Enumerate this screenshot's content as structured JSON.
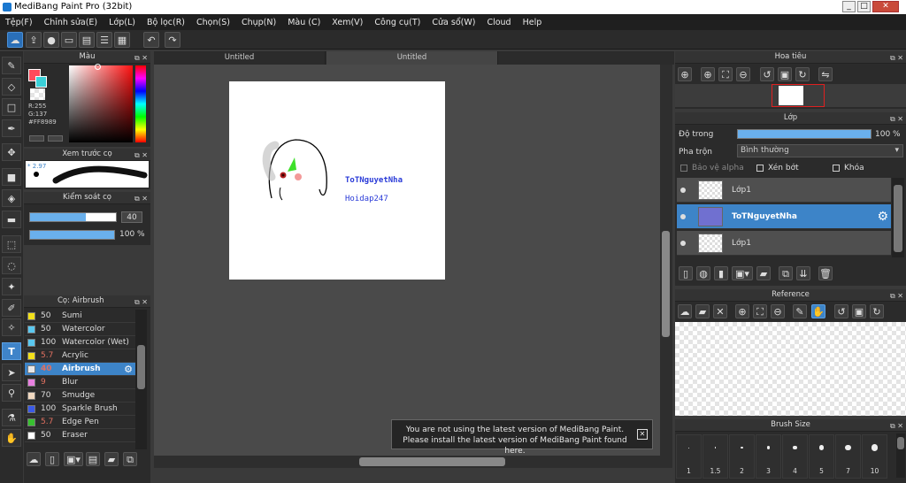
{
  "window": {
    "title": "MediBang Paint Pro (32bit)",
    "minimize": "_",
    "maximize": "□",
    "close": "✕"
  },
  "menu": [
    "Tệp(F)",
    "Chỉnh sửa(E)",
    "Lớp(L)",
    "Bộ lọc(R)",
    "Chọn(S)",
    "Chụp(N)",
    "Màu (C)",
    "Xem(V)",
    "Công cụ(T)",
    "Cửa sổ(W)",
    "Cloud",
    "Help"
  ],
  "color_panel": {
    "title": "Màu",
    "r": "R:255",
    "g": "G:137",
    "hex": "#FF8989"
  },
  "preview_panel": {
    "title": "Xem trước cọ",
    "size": "2.97"
  },
  "brush_control": {
    "title": "Kiểm soát cọ",
    "size_value": "40",
    "size_fill": 0.65,
    "opacity_value": "100 %",
    "opacity_fill": 1.0
  },
  "brush_list": {
    "title": "Cọ: Airbrush",
    "items": [
      {
        "size": "50",
        "name": "Sumi",
        "color": "#f2e01a",
        "red": false
      },
      {
        "size": "50",
        "name": "Watercolor",
        "color": "#5ac8f0",
        "red": false
      },
      {
        "size": "100",
        "name": "Watercolor (Wet)",
        "color": "#5ac8f0",
        "red": false
      },
      {
        "size": "5.7",
        "name": "Acrylic",
        "color": "#f2e01a",
        "red": true
      },
      {
        "size": "40",
        "name": "Airbrush",
        "color": "#e8e8e8",
        "red": true
      },
      {
        "size": "9",
        "name": "Blur",
        "color": "#e880e0",
        "red": true
      },
      {
        "size": "70",
        "name": "Smudge",
        "color": "#f0d8c0",
        "red": false
      },
      {
        "size": "100",
        "name": "Sparkle Brush",
        "color": "#3a5ae8",
        "red": false
      },
      {
        "size": "5.7",
        "name": "Edge Pen",
        "color": "#38c030",
        "red": true
      },
      {
        "size": "50",
        "name": "Eraser",
        "color": "#ffffff",
        "red": false
      }
    ],
    "selected": 4
  },
  "tabs": [
    "Untitled",
    "Untitled"
  ],
  "canvas": {
    "text1": "ToTNguyetNha",
    "text2": "Hoidap247"
  },
  "notification": {
    "line1": "You are not using the latest version of MediBang Paint.",
    "line2": "Please install the latest version of MediBang Paint found here.",
    "close": "✕"
  },
  "navigator": {
    "title": "Hoa tiêu"
  },
  "layers": {
    "title": "Lớp",
    "opacity_label": "Độ trong",
    "opacity_value": "100 %",
    "opacity_fill": 1.0,
    "blend_label": "Pha trộn",
    "blend_value": "Bình thường",
    "protect_alpha": "Bảo vệ alpha",
    "clipping": "Xén bớt",
    "lock": "Khóa",
    "items": [
      {
        "name": "Lớp1",
        "selected": false
      },
      {
        "name": "ToTNguyetNha",
        "selected": true
      },
      {
        "name": "Lớp1",
        "selected": false
      }
    ]
  },
  "reference": {
    "title": "Reference"
  },
  "brush_size": {
    "title": "Brush Size",
    "sizes": [
      "1",
      "1.5",
      "2",
      "3",
      "4",
      "5",
      "7",
      "10"
    ]
  },
  "colors": {
    "accent": "#3d84c8",
    "swatch_main": "#ff4b5c",
    "swatch_sub": "#3ad0d8"
  }
}
